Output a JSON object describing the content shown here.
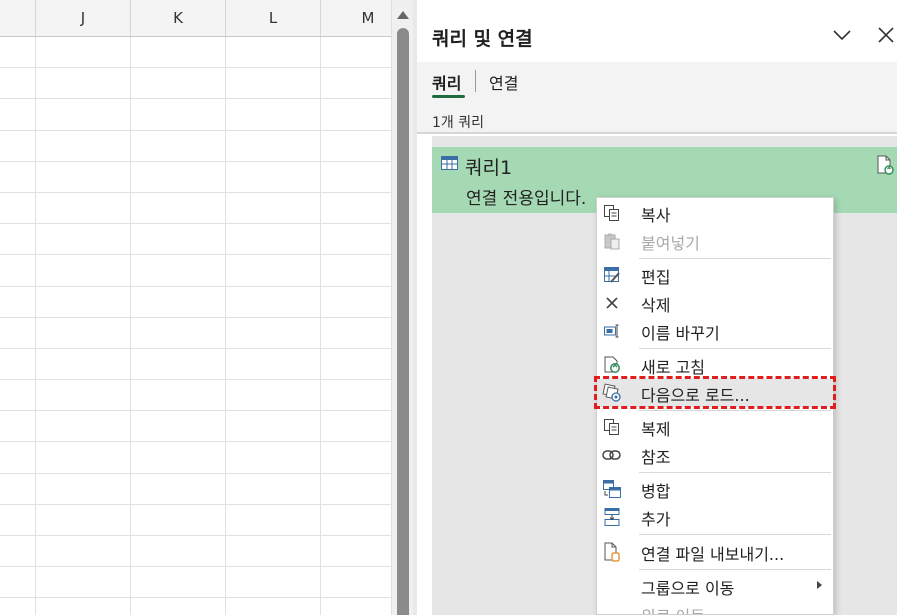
{
  "grid": {
    "columns": [
      "J",
      "K",
      "L",
      "M"
    ]
  },
  "panel": {
    "title": "쿼리 및 연결",
    "tabs": [
      {
        "label": "쿼리",
        "active": true
      },
      {
        "label": "연결",
        "active": false
      }
    ],
    "count_text": "1개 쿼리",
    "query": {
      "name": "쿼리1",
      "subtitle": "연결 전용입니다."
    }
  },
  "context_menu": {
    "items": [
      {
        "label": "복사",
        "icon": "copy-icon",
        "disabled": false
      },
      {
        "label": "붙여넣기",
        "icon": "paste-icon",
        "disabled": true
      },
      {
        "label": "편집",
        "icon": "edit-table-icon",
        "disabled": false
      },
      {
        "label": "삭제",
        "icon": "delete-x-icon",
        "disabled": false
      },
      {
        "label": "이름 바꾸기",
        "icon": "rename-icon",
        "disabled": false
      },
      {
        "label": "새로 고침",
        "icon": "refresh-icon",
        "disabled": false
      },
      {
        "label": "다음으로 로드...",
        "icon": "load-to-icon",
        "disabled": false,
        "highlighted": true
      },
      {
        "label": "복제",
        "icon": "duplicate-icon",
        "disabled": false
      },
      {
        "label": "참조",
        "icon": "reference-link-icon",
        "disabled": false
      },
      {
        "label": "병합",
        "icon": "merge-icon",
        "disabled": false
      },
      {
        "label": "추가",
        "icon": "append-icon",
        "disabled": false
      },
      {
        "label": "연결 파일 내보내기...",
        "icon": "export-connection-icon",
        "disabled": false
      },
      {
        "label": "그룹으로 이동",
        "icon": "",
        "disabled": false,
        "submenu": true
      },
      {
        "label": "위로 이동",
        "icon": "",
        "disabled": true
      }
    ]
  },
  "colors": {
    "accent_green": "#1d6b3f",
    "query_item_bg": "#a5d9b4",
    "focus_outline": "#e01e1e"
  }
}
